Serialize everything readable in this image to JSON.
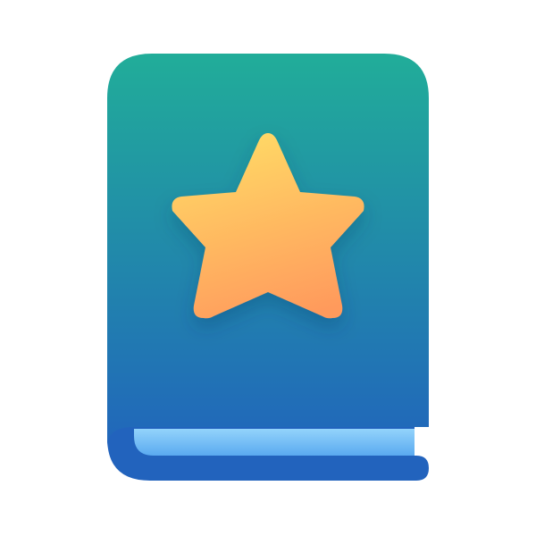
{
  "icon": {
    "name": "favorite-book-icon",
    "colors": {
      "cover_top": "#21ad99",
      "cover_bottom": "#2166bb",
      "spine_dark": "#2263bd",
      "pages_top": "#93d3fb",
      "pages_bottom": "#5aaaf0",
      "star_top": "#ffd966",
      "star_bottom": "#ff9a5c"
    }
  }
}
